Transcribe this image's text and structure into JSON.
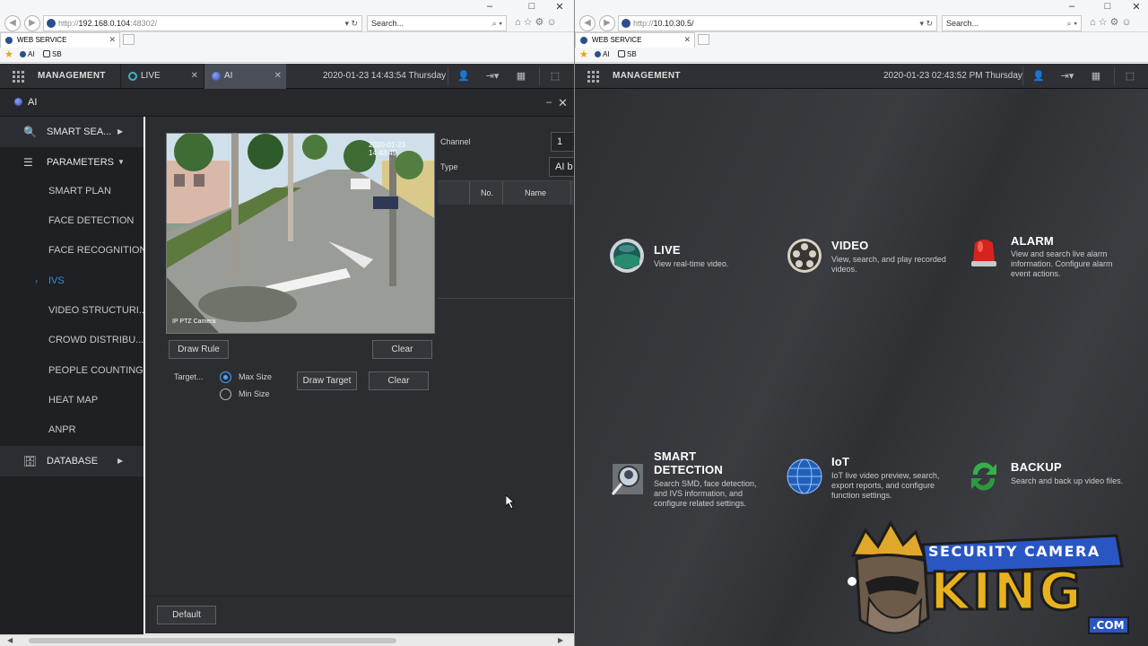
{
  "left": {
    "address": {
      "prefix": "http://",
      "host": "192.168.0.104",
      "port": ":48302/"
    },
    "search_placeholder": "Search...",
    "tab_title": "WEB SERVICE",
    "favorites": [
      "AI",
      "SB"
    ],
    "app": {
      "menu_label": "MANAGEMENT",
      "tabs": [
        {
          "label": "LIVE"
        },
        {
          "label": "AI"
        }
      ],
      "datetime": "2020-01-23 14:43:54 Thursday"
    },
    "dialog_title": "AI",
    "sidebar": {
      "smart_search": "SMART SEA...",
      "parameters": "PARAMETERS",
      "items": [
        "SMART PLAN",
        "FACE DETECTION",
        "FACE RECOGNITION",
        "IVS",
        "VIDEO STRUCTURI...",
        "CROWD DISTRIBU...",
        "PEOPLE COUNTING",
        "HEAT MAP",
        "ANPR"
      ],
      "database": "DATABASE"
    },
    "video": {
      "timestamp": "2020-01-23 14:43:49",
      "camera_label": "IP PTZ Camera"
    },
    "buttons": {
      "draw_rule": "Draw Rule",
      "clear1": "Clear",
      "draw_target": "Draw Target",
      "clear2": "Clear",
      "default": "Default"
    },
    "target": {
      "label": "Target...",
      "max_size": "Max Size",
      "min_size": "Min Size",
      "selected": "Max Size"
    },
    "channel": {
      "label": "Channel",
      "value": "1"
    },
    "type": {
      "label": "Type",
      "value": "AI b"
    },
    "table": {
      "columns": [
        "No.",
        "Name"
      ],
      "rows": []
    }
  },
  "right": {
    "address": {
      "prefix": "http://",
      "host": "10.10.30.5/"
    },
    "search_placeholder": "Search...",
    "tab_title": "WEB SERVICE",
    "favorites": [
      "AI",
      "SB"
    ],
    "app": {
      "menu_label": "MANAGEMENT",
      "datetime": "2020-01-23 02:43:52 PM Thursday"
    },
    "tiles": [
      {
        "title": "LIVE",
        "desc": "View real-time video."
      },
      {
        "title": "VIDEO",
        "desc": "View, search, and play recorded videos."
      },
      {
        "title": "ALARM",
        "desc": "View and search live alarm information. Configure alarm event actions."
      },
      {
        "title": "SMART",
        "title2": "DETECTION",
        "desc": "Search SMD, face detection, and IVS information, and configure related settings."
      },
      {
        "title": "IoT",
        "desc": "IoT live video preview, search, export reports, and configure function settings."
      },
      {
        "title": "BACKUP",
        "desc": "Search and back up video files."
      }
    ],
    "logo": {
      "line1": "SECURITY CAMERA",
      "line2": "KING",
      "line3": ".COM"
    }
  },
  "colors": {
    "accent_blue": "#2f8fe0",
    "panel": "#2b2d31",
    "sidebar": "#1f2023"
  }
}
